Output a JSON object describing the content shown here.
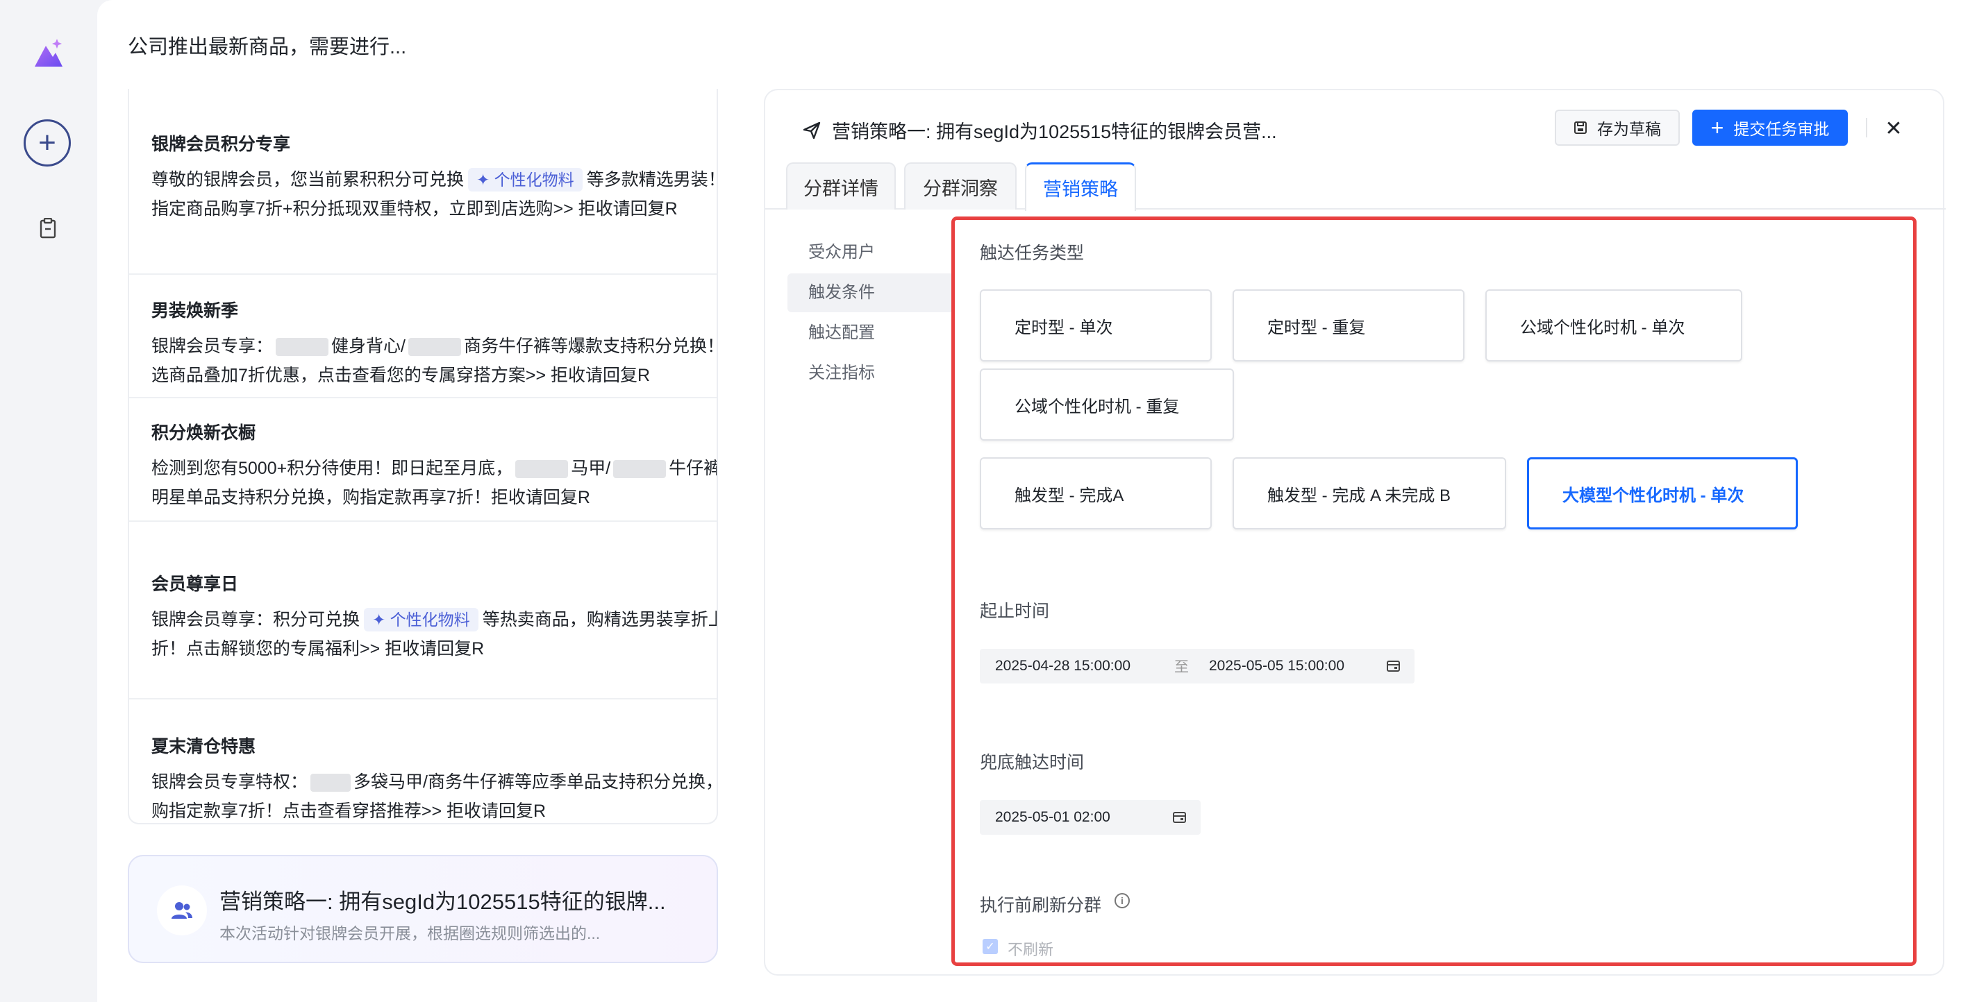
{
  "page": {
    "title": "公司推出最新商品，需要进行..."
  },
  "messages": [
    {
      "title": "银牌会员积分专享",
      "line1_a": "尊敬的银牌会员，您当前累积积分可兑换",
      "tag": "✦ 个性化物料",
      "line1_b": "等多款精选男装！",
      "line2": "指定商品购享7折+积分抵现双重特权，立即到店选购>> 拒收请回复R"
    },
    {
      "title": "男装焕新季",
      "line1_a": "银牌会员专享：",
      "line1_b": "健身背心/",
      "line1_c": "商务牛仔裤等爆款支持积分兑换！精",
      "line2": "选商品叠加7折优惠，点击查看您的专属穿搭方案>> 拒收请回复R"
    },
    {
      "title": "积分焕新衣橱",
      "line1_a": "检测到您有5000+积分待使用！即日起至月底，",
      "line1_b": "马甲/",
      "line1_c": "牛仔裤等",
      "line2": "明星单品支持积分兑换，购指定款再享7折！拒收请回复R"
    },
    {
      "title": "会员尊享日",
      "line1_a": "银牌会员尊享：积分可兑换",
      "tag": "✦ 个性化物料",
      "line1_b": "等热卖商品，购精选男装享折上",
      "line2": "折！点击解锁您的专属福利>> 拒收请回复R"
    },
    {
      "title": "夏末清仓特惠",
      "line1_a": "银牌会员专享特权：",
      "line1_b": "多袋马甲/商务牛仔裤等应季单品支持积分兑换，",
      "line2": "购指定款享7折！点击查看穿搭推荐>> 拒收请回复R"
    }
  ],
  "summary": {
    "title": "营销策略一: 拥有segId为1025515特征的银牌...",
    "desc": "本次活动针对银牌会员开展，根据圈选规则筛选出的..."
  },
  "panel": {
    "title": "营销策略一: 拥有segId为1025515特征的银牌会员营...",
    "draft_label": "存为草稿",
    "submit_label": "提交任务审批",
    "tabs": [
      "分群详情",
      "分群洞察",
      "营销策略"
    ],
    "nav": [
      "受众用户",
      "触发条件",
      "触达配置",
      "关注指标"
    ]
  },
  "form": {
    "task_type_label": "触达任务类型",
    "options": [
      "定时型 - 单次",
      "定时型 - 重复",
      "公域个性化时机 - 单次",
      "公域个性化时机 - 重复",
      "触发型 - 完成A",
      "触发型 - 完成 A 未完成 B",
      "大模型个性化时机 - 单次"
    ],
    "time_label": "起止时间",
    "start": "2025-04-28 15:00:00",
    "to": "至",
    "end": "2025-05-05 15:00:00",
    "fallback_label": "兜底触达时间",
    "fallback_time": "2025-05-01 02:00",
    "refresh_label": "执行前刷新分群",
    "no_refresh_label": "不刷新"
  },
  "colors": {
    "accent": "#1668ff",
    "highlight_border": "#e84040"
  }
}
